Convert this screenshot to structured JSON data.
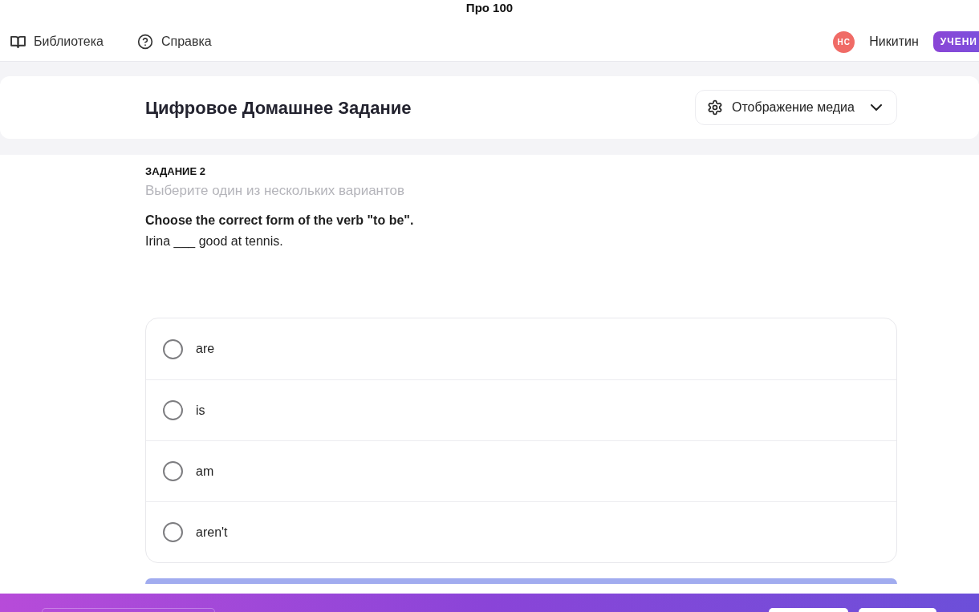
{
  "top_title": "Про 100",
  "nav": {
    "links": [
      {
        "label": "Библиотека"
      },
      {
        "label": "Справка"
      }
    ],
    "user": {
      "initials": "НС",
      "name": "Никитин",
      "role": "УЧЕНИ"
    }
  },
  "header": {
    "title": "Цифровое Домашнее Задание",
    "media_button": {
      "label": "Отображение медиа"
    }
  },
  "task": {
    "number": "ЗАДАНИЕ 2",
    "instruction": "Выберите один из нескольких вариантов",
    "question": "Choose the correct form of the verb \"to be\".",
    "sentence": "Irina ___ good at tennis.",
    "options": [
      {
        "label": "are",
        "selected": false
      },
      {
        "label": "is",
        "selected": false
      },
      {
        "label": "am",
        "selected": false
      },
      {
        "label": "aren't",
        "selected": false
      }
    ]
  }
}
